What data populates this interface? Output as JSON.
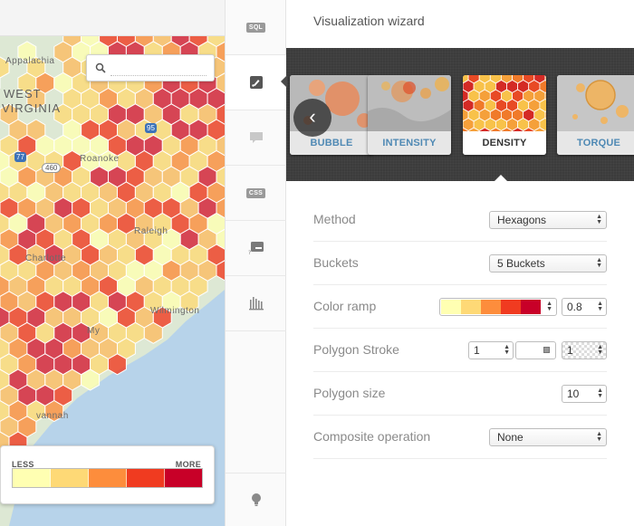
{
  "map": {
    "labels": {
      "appalachia": "Appalachia",
      "west": "WEST",
      "virginia": "VIRGINIA",
      "roanoke": "Roanoke",
      "wilmington": "Wilmington",
      "charlotte": "Charlotte",
      "raleigh": "Raleigh",
      "myrtle": "My",
      "savannah": "vannah",
      "hwy77": "77",
      "hwy95": "95",
      "hwy460": "460"
    },
    "search": {
      "placeholder": ""
    },
    "legend": {
      "less": "LESS",
      "more": "MORE",
      "colors": [
        "#ffffb2",
        "#fed976",
        "#fd8d3c",
        "#f03b20",
        "#c80028"
      ]
    },
    "hex_colors": [
      "#ffffb2",
      "#fed976",
      "#fdbb62",
      "#fd8d3c",
      "#f03b20",
      "#d41c33"
    ]
  },
  "toolbar": {
    "sql_label": "SQL",
    "css_label": "CSS"
  },
  "panel": {
    "title": "Visualization wizard",
    "carousel": {
      "cards": [
        {
          "label": "BUBBLE",
          "active": false
        },
        {
          "label": "INTENSITY",
          "active": false
        },
        {
          "label": "DENSITY",
          "active": true
        },
        {
          "label": "TORQUE",
          "active": false
        }
      ]
    },
    "rows": {
      "method": {
        "label": "Method",
        "value": "Hexagons"
      },
      "buckets": {
        "label": "Buckets",
        "value": "5 Buckets"
      },
      "color_ramp": {
        "label": "Color ramp",
        "opacity": "0.8",
        "colors": [
          "#ffffb2",
          "#fed976",
          "#fd8d3c",
          "#f03b20",
          "#c80028"
        ]
      },
      "polygon_stroke": {
        "label": "Polygon Stroke",
        "width": "1",
        "opacity": "1"
      },
      "polygon_size": {
        "label": "Polygon size",
        "value": "10"
      },
      "composite": {
        "label": "Composite operation",
        "value": "None"
      }
    }
  }
}
